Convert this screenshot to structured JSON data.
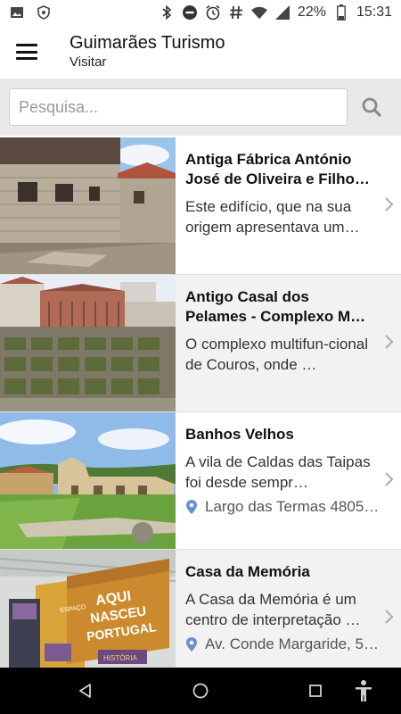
{
  "status_bar": {
    "battery": "22%",
    "time": "15:31",
    "icons": [
      "image-icon",
      "shield-icon",
      "bluetooth-icon",
      "do-not-disturb-icon",
      "alarm-icon",
      "hashtag-icon",
      "wifi-icon",
      "signal-icon",
      "battery-icon"
    ]
  },
  "app_bar": {
    "title": "Guimarães Turismo",
    "subtitle": "Visitar"
  },
  "search": {
    "placeholder": "Pesquisa..."
  },
  "items": [
    {
      "title": "Antiga Fábrica António José de Oliveira e Filho…",
      "description": "Este edifício, que na sua origem apresentava um…",
      "location": ""
    },
    {
      "title": "Antigo Casal dos Pelames - Complexo M…",
      "description": "O complexo multifun-cional de Couros, onde …",
      "location": ""
    },
    {
      "title": "Banhos Velhos",
      "description": "A vila de Caldas das Taipas foi desde sempr…",
      "location": "Largo das Termas 4805…"
    },
    {
      "title": "Casa da Memória",
      "description": "A Casa da Memória é um centro de interpretação …",
      "location": "Av. Conde Margaride, 5…"
    }
  ],
  "thumb_text": {
    "line1": "AQUI",
    "line2": "NASCEU",
    "line3": "PORTUGAL",
    "sign_left": "ESPAÇO",
    "sign_right": "HISTÓRIA"
  },
  "colors": {
    "accent_pin": "#6a8fd1",
    "alt_row": "#f2f2f2",
    "search_band": "#e9e9e9"
  }
}
